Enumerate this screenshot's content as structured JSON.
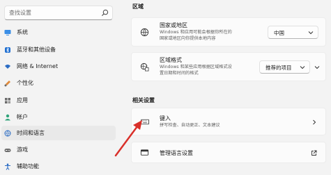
{
  "search": {
    "placeholder": "查找设置"
  },
  "sidebar": {
    "items": [
      {
        "label": "系统",
        "icon": "monitor-icon"
      },
      {
        "label": "蓝牙和其他设备",
        "icon": "bluetooth-icon"
      },
      {
        "label": "网络 & Internet",
        "icon": "wifi-icon"
      },
      {
        "label": "个性化",
        "icon": "brush-icon"
      },
      {
        "label": "应用",
        "icon": "apps-icon"
      },
      {
        "label": "帐户",
        "icon": "person-icon"
      },
      {
        "label": "时间和语言",
        "icon": "globe-clock-icon",
        "active": true
      },
      {
        "label": "游戏",
        "icon": "gamepad-icon"
      },
      {
        "label": "辅助功能",
        "icon": "accessibility-icon"
      }
    ]
  },
  "main": {
    "region_section": "区域",
    "country": {
      "title": "国家或地区",
      "desc_line1": "Windows 和应用可能会根据你所在的",
      "desc_line2": "国家或地区向你提供本地内容",
      "value": "中国"
    },
    "format": {
      "title": "区域格式",
      "desc_line1": "Windows 和某些应用根据区域格式设",
      "desc_line2": "置日期和时间的格式",
      "value": "推荐的项目"
    },
    "related_section": "相关设置",
    "typing": {
      "title": "键入",
      "desc": "拼写检查、自动更正、文本建议"
    },
    "admin_lang": {
      "title": "管理语言设置"
    }
  },
  "colors": {
    "accent": "#0067c0",
    "arrow": "#d9302a"
  }
}
